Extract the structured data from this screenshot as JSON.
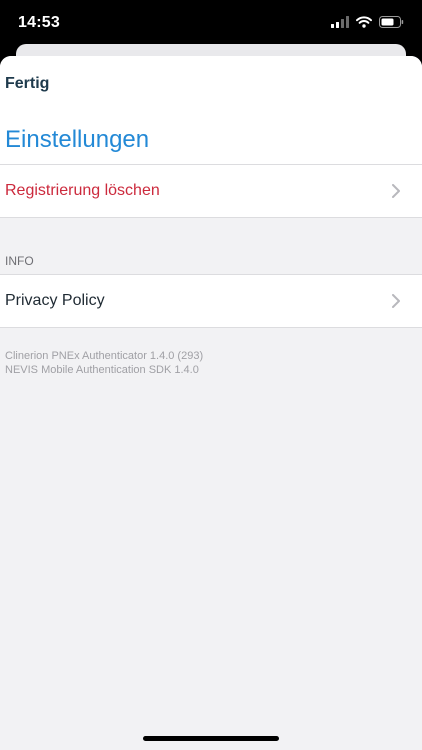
{
  "status_bar": {
    "time": "14:53",
    "icons": [
      "cellular-signal-icon",
      "wifi-icon",
      "battery-icon"
    ]
  },
  "sheet": {
    "done_label": "Fertig",
    "title": "Einstellungen"
  },
  "settings": {
    "delete_registration_label": "Registrierung löschen",
    "info_section_header": "INFO",
    "privacy_policy_label": "Privacy Policy"
  },
  "footer": {
    "app_version": "Clinerion PNEx Authenticator 1.4.0 (293)",
    "sdk_version": "NEVIS Mobile Authentication SDK 1.4.0"
  },
  "colors": {
    "title_blue": "#2389d6",
    "danger_red": "#cc2a3d",
    "done_dark": "#1e3a4c"
  }
}
